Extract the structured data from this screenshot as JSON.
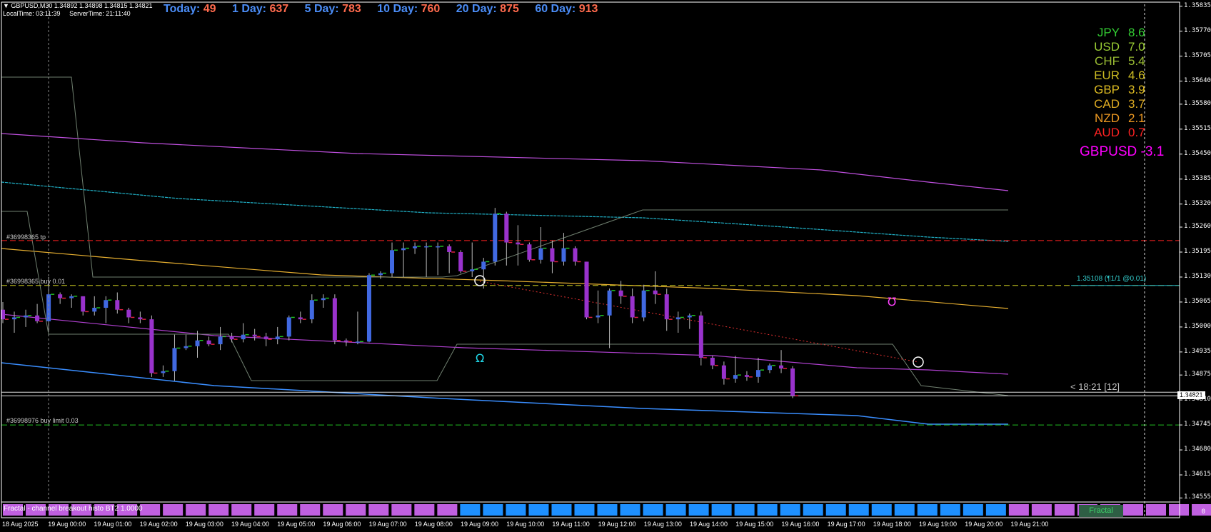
{
  "header": {
    "symbol_line": "▼ GBPUSD,M30  1.34892 1.34898 1.34815 1.34821",
    "local_time": "LocalTime: 03:11:39",
    "server_time": "ServerTime: 21:11:40"
  },
  "ranges": [
    {
      "label": "Today:",
      "value": "49"
    },
    {
      "label": "1 Day:",
      "value": "637"
    },
    {
      "label": "5 Day:",
      "value": "783"
    },
    {
      "label": "10 Day:",
      "value": "760"
    },
    {
      "label": "20 Day:",
      "value": "875"
    },
    {
      "label": "60 Day:",
      "value": "913"
    }
  ],
  "currency_strength": [
    {
      "ccy": "JPY",
      "val": "8.6",
      "color": "#33cc33"
    },
    {
      "ccy": "USD",
      "val": "7.0",
      "color": "#99cc33"
    },
    {
      "ccy": "CHF",
      "val": "5.4",
      "color": "#99bb33"
    },
    {
      "ccy": "EUR",
      "val": "4.6",
      "color": "#ccbb22"
    },
    {
      "ccy": "GBP",
      "val": "3.9",
      "color": "#ddbb22"
    },
    {
      "ccy": "CAD",
      "val": "3.7",
      "color": "#ddaa22"
    },
    {
      "ccy": "NZD",
      "val": "2.1",
      "color": "#ee9922"
    },
    {
      "ccy": "AUD",
      "val": "0.7",
      "color": "#ff2222"
    }
  ],
  "pair_strength": "GBPUSD -3.1",
  "order_labels": {
    "tp": "#36998365 tp",
    "buy": "#36998365 buy 0.01",
    "limit": "#36998976 buy limit 0.03"
  },
  "trade_label": "1.35108 (¶1/1 @0.01)",
  "timer": "< 18:21 [12]",
  "current_price": "1.34821",
  "indicator_label": "Fractal - channel breakout histo BT2 1.0000",
  "fractal_button": "Fractal",
  "y_axis": [
    "1.35835",
    "1.35770",
    "1.35705",
    "1.35640",
    "1.35580",
    "1.35515",
    "1.35450",
    "1.35385",
    "1.35320",
    "1.35260",
    "1.35195",
    "1.35130",
    "1.35065",
    "1.35000",
    "1.34935",
    "1.34875",
    "1.34810",
    "1.34745",
    "1.34680",
    "1.34615",
    "1.34555"
  ],
  "x_axis": [
    "18 Aug 2025",
    "19 Aug 00:00",
    "19 Aug 01:00",
    "19 Aug 02:00",
    "19 Aug 03:00",
    "19 Aug 04:00",
    "19 Aug 05:00",
    "19 Aug 06:00",
    "19 Aug 07:00",
    "19 Aug 08:00",
    "19 Aug 09:00",
    "19 Aug 10:00",
    "19 Aug 11:00",
    "19 Aug 12:00",
    "19 Aug 13:00",
    "19 Aug 14:00",
    "19 Aug 15:00",
    "19 Aug 16:00",
    "19 Aug 17:00",
    "19 Aug 18:00",
    "19 Aug 19:00",
    "19 Aug 20:00",
    "19 Aug 21:00"
  ],
  "histo_subaxis": [
    "0"
  ],
  "colors": {
    "bull": "#4169e1",
    "bear": "#9932cc",
    "tp_line": "#ff2020",
    "buy_line": "#c8c820",
    "limit_line": "#20c020",
    "histo_bear": "#c060e0",
    "histo_bull": "#1e90ff"
  },
  "chart_data": {
    "type": "candlestick",
    "timeframe": "M30",
    "ylim": [
      1.3455,
      1.3584
    ],
    "candles": [
      {
        "o": 1.35045,
        "h": 1.35065,
        "l": 1.3501,
        "c": 1.3502
      },
      {
        "o": 1.3502,
        "h": 1.3504,
        "l": 1.34985,
        "c": 1.35025
      },
      {
        "o": 1.35025,
        "h": 1.35045,
        "l": 1.35,
        "c": 1.3503
      },
      {
        "o": 1.3503,
        "h": 1.3506,
        "l": 1.3501,
        "c": 1.35015
      },
      {
        "o": 1.35015,
        "h": 1.3513,
        "l": 1.3499,
        "c": 1.35085
      },
      {
        "o": 1.35085,
        "h": 1.3509,
        "l": 1.3506,
        "c": 1.35075
      },
      {
        "o": 1.35075,
        "h": 1.35085,
        "l": 1.3505,
        "c": 1.3508
      },
      {
        "o": 1.3508,
        "h": 1.3508,
        "l": 1.3503,
        "c": 1.3504
      },
      {
        "o": 1.3504,
        "h": 1.3508,
        "l": 1.3503,
        "c": 1.3505
      },
      {
        "o": 1.3505,
        "h": 1.3508,
        "l": 1.3501,
        "c": 1.3507
      },
      {
        "o": 1.3507,
        "h": 1.3509,
        "l": 1.35035,
        "c": 1.35045
      },
      {
        "o": 1.35045,
        "h": 1.3505,
        "l": 1.3501,
        "c": 1.35025
      },
      {
        "o": 1.35025,
        "h": 1.3504,
        "l": 1.3501,
        "c": 1.3502
      },
      {
        "o": 1.3502,
        "h": 1.3503,
        "l": 1.3487,
        "c": 1.3488
      },
      {
        "o": 1.3488,
        "h": 1.349,
        "l": 1.3487,
        "c": 1.34885
      },
      {
        "o": 1.34885,
        "h": 1.3498,
        "l": 1.3486,
        "c": 1.34945
      },
      {
        "o": 1.34945,
        "h": 1.3498,
        "l": 1.3494,
        "c": 1.3495
      },
      {
        "o": 1.3495,
        "h": 1.3499,
        "l": 1.3492,
        "c": 1.34965
      },
      {
        "o": 1.34965,
        "h": 1.34975,
        "l": 1.3495,
        "c": 1.34955
      },
      {
        "o": 1.34955,
        "h": 1.35,
        "l": 1.3494,
        "c": 1.34975
      },
      {
        "o": 1.34975,
        "h": 1.34985,
        "l": 1.3496,
        "c": 1.34968
      },
      {
        "o": 1.34968,
        "h": 1.3501,
        "l": 1.3496,
        "c": 1.3498
      },
      {
        "o": 1.3498,
        "h": 1.34995,
        "l": 1.34965,
        "c": 1.34975
      },
      {
        "o": 1.34975,
        "h": 1.34985,
        "l": 1.3495,
        "c": 1.34968
      },
      {
        "o": 1.34968,
        "h": 1.35,
        "l": 1.34955,
        "c": 1.34975
      },
      {
        "o": 1.34975,
        "h": 1.3503,
        "l": 1.34965,
        "c": 1.35025
      },
      {
        "o": 1.35025,
        "h": 1.3504,
        "l": 1.3501,
        "c": 1.3502
      },
      {
        "o": 1.3502,
        "h": 1.35085,
        "l": 1.3501,
        "c": 1.3507
      },
      {
        "o": 1.3507,
        "h": 1.35085,
        "l": 1.3505,
        "c": 1.35075
      },
      {
        "o": 1.35075,
        "h": 1.35085,
        "l": 1.34955,
        "c": 1.34965
      },
      {
        "o": 1.34965,
        "h": 1.3497,
        "l": 1.3495,
        "c": 1.34962
      },
      {
        "o": 1.34962,
        "h": 1.3504,
        "l": 1.34955,
        "c": 1.34962
      },
      {
        "o": 1.34962,
        "h": 1.3514,
        "l": 1.3496,
        "c": 1.35135
      },
      {
        "o": 1.35135,
        "h": 1.35145,
        "l": 1.35125,
        "c": 1.3514
      },
      {
        "o": 1.3514,
        "h": 1.3522,
        "l": 1.3513,
        "c": 1.352
      },
      {
        "o": 1.352,
        "h": 1.3522,
        "l": 1.3513,
        "c": 1.35205
      },
      {
        "o": 1.35205,
        "h": 1.3522,
        "l": 1.3519,
        "c": 1.3521
      },
      {
        "o": 1.3521,
        "h": 1.3522,
        "l": 1.3513,
        "c": 1.3521
      },
      {
        "o": 1.3521,
        "h": 1.3522,
        "l": 1.35135,
        "c": 1.3521
      },
      {
        "o": 1.3521,
        "h": 1.35215,
        "l": 1.3514,
        "c": 1.35195
      },
      {
        "o": 1.35195,
        "h": 1.352,
        "l": 1.3514,
        "c": 1.35145
      },
      {
        "o": 1.35145,
        "h": 1.3522,
        "l": 1.3513,
        "c": 1.3515
      },
      {
        "o": 1.3515,
        "h": 1.3518,
        "l": 1.351,
        "c": 1.3517
      },
      {
        "o": 1.3517,
        "h": 1.3531,
        "l": 1.3516,
        "c": 1.35295
      },
      {
        "o": 1.35295,
        "h": 1.353,
        "l": 1.3516,
        "c": 1.3522
      },
      {
        "o": 1.3522,
        "h": 1.35265,
        "l": 1.3516,
        "c": 1.35215
      },
      {
        "o": 1.35215,
        "h": 1.3522,
        "l": 1.3517,
        "c": 1.35175
      },
      {
        "o": 1.35175,
        "h": 1.3526,
        "l": 1.35165,
        "c": 1.35205
      },
      {
        "o": 1.35205,
        "h": 1.35225,
        "l": 1.3514,
        "c": 1.3517
      },
      {
        "o": 1.3517,
        "h": 1.35245,
        "l": 1.3516,
        "c": 1.35205
      },
      {
        "o": 1.35205,
        "h": 1.3521,
        "l": 1.3516,
        "c": 1.3517
      },
      {
        "o": 1.3517,
        "h": 1.3517,
        "l": 1.3502,
        "c": 1.35025
      },
      {
        "o": 1.35025,
        "h": 1.35095,
        "l": 1.3501,
        "c": 1.3503
      },
      {
        "o": 1.3503,
        "h": 1.351,
        "l": 1.34945,
        "c": 1.35095
      },
      {
        "o": 1.35095,
        "h": 1.3512,
        "l": 1.3506,
        "c": 1.3508
      },
      {
        "o": 1.3508,
        "h": 1.351,
        "l": 1.3501,
        "c": 1.35025
      },
      {
        "o": 1.35025,
        "h": 1.3511,
        "l": 1.35015,
        "c": 1.35095
      },
      {
        "o": 1.35095,
        "h": 1.35145,
        "l": 1.3506,
        "c": 1.35085
      },
      {
        "o": 1.35085,
        "h": 1.351,
        "l": 1.3499,
        "c": 1.3502
      },
      {
        "o": 1.3502,
        "h": 1.3504,
        "l": 1.34985,
        "c": 1.35025
      },
      {
        "o": 1.35025,
        "h": 1.35035,
        "l": 1.34995,
        "c": 1.3503
      },
      {
        "o": 1.3503,
        "h": 1.3504,
        "l": 1.349,
        "c": 1.3492
      },
      {
        "o": 1.3492,
        "h": 1.34925,
        "l": 1.3489,
        "c": 1.349
      },
      {
        "o": 1.349,
        "h": 1.3491,
        "l": 1.3485,
        "c": 1.34865
      },
      {
        "o": 1.34865,
        "h": 1.34925,
        "l": 1.34855,
        "c": 1.34875
      },
      {
        "o": 1.34875,
        "h": 1.34885,
        "l": 1.3486,
        "c": 1.3487
      },
      {
        "o": 1.3487,
        "h": 1.3492,
        "l": 1.34855,
        "c": 1.34888
      },
      {
        "o": 1.34888,
        "h": 1.34905,
        "l": 1.3488,
        "c": 1.349
      },
      {
        "o": 1.349,
        "h": 1.3494,
        "l": 1.3488,
        "c": 1.34892
      },
      {
        "o": 1.34892,
        "h": 1.34898,
        "l": 1.34815,
        "c": 1.34821
      }
    ],
    "horizontal_levels": {
      "tp": 1.35225,
      "buy_entry": 1.35108,
      "buy_limit": 1.34745,
      "current": 1.34821
    },
    "histogram": [
      "bear",
      "bear",
      "bear",
      "bear",
      "bear",
      "bear",
      "bear",
      "bear",
      "bear",
      "bear",
      "bear",
      "bear",
      "bear",
      "bear",
      "bear",
      "bear",
      "bear",
      "bear",
      "bear",
      "bear",
      "bull",
      "bull",
      "bull",
      "bull",
      "bull",
      "bull",
      "bull",
      "bull",
      "bull",
      "bull",
      "bull",
      "bull",
      "bull",
      "bull",
      "bull",
      "bull",
      "bull",
      "bull",
      "bull",
      "bull",
      "bull",
      "bull",
      "bull",
      "bull",
      "bear",
      "bear",
      "bear",
      "bear",
      "bear",
      "bear",
      "bear",
      "bear",
      "bear",
      "bear",
      "bear"
    ]
  }
}
